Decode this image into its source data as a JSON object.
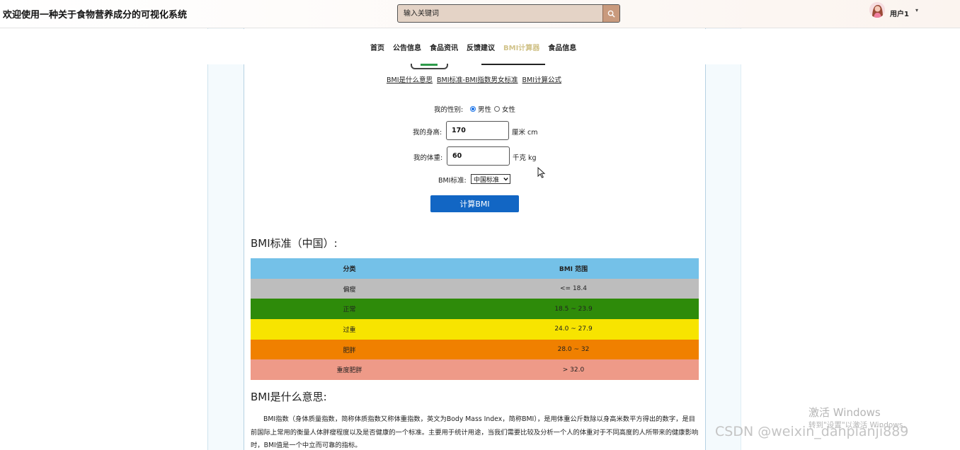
{
  "header": {
    "site_title": "欢迎使用一种关于食物营养成分的可视化系统",
    "search_placeholder": "输入关键词",
    "search_icon": "search-icon",
    "user_name": "用户1",
    "user_caret": "▾"
  },
  "nav": {
    "items": [
      {
        "label": "首页",
        "active": false
      },
      {
        "label": "公告信息",
        "active": false
      },
      {
        "label": "食品资讯",
        "active": false
      },
      {
        "label": "反馈建议",
        "active": false
      },
      {
        "label": "BMI计算器",
        "active": true
      },
      {
        "label": "食品信息",
        "active": false
      }
    ],
    "active_color": "#d1c38a"
  },
  "links": [
    "BMI是什么意思",
    "BMI标准-BMI指数男女标准",
    "BMI计算公式"
  ],
  "form": {
    "gender_label": "我的性别:",
    "gender_options": [
      {
        "label": "男性",
        "checked": true
      },
      {
        "label": "女性",
        "checked": false
      }
    ],
    "height_label": "我的身高:",
    "height_value": "170",
    "height_unit": "厘米 cm",
    "weight_label": "我的体重:",
    "weight_value": "60",
    "weight_unit": "千克 kg",
    "standard_label": "BMI标准:",
    "standard_value": "中国标准",
    "calc_button": "计算BMI",
    "button_color": "#1266c4"
  },
  "table_section": {
    "heading": "BMI标准（中国）:",
    "columns": [
      "分类",
      "BMI 范围"
    ],
    "rows": [
      {
        "category": "偏瘦",
        "range": "<= 18.4",
        "color": "#bdbdbd"
      },
      {
        "category": "正常",
        "range": "18.5 ~ 23.9",
        "color": "#2e8b0a"
      },
      {
        "category": "过重",
        "range": "24.0 ~ 27.9",
        "color": "#f7e400"
      },
      {
        "category": "肥胖",
        "range": "28.0 ~ 32",
        "color": "#f08000"
      },
      {
        "category": "重度肥胖",
        "range": "> 32.0",
        "color": "#ee9a88"
      }
    ],
    "header_color": "#74c1e8"
  },
  "meaning_section": {
    "heading": "BMI是什么意思:",
    "paragraph": "BMI指数（身体质量指数，简称体质指数又称体重指数，英文为Body Mass Index，简称BMI），是用体重公斤数除以身高米数平方得出的数字，是目前国际上常用的衡量人体胖瘦程度以及是否健康的一个标准。主要用于统计用途，当我们需要比较及分析一个人的体重对于不同高度的人所带来的健康影响时，BMI值是一个中立而可靠的指标。"
  },
  "watermarks": {
    "activate_title": "激活 Windows",
    "activate_sub": "转到\"设置\"以激活 Windows。",
    "csdn": "CSDN @weixin_danpianji889"
  }
}
